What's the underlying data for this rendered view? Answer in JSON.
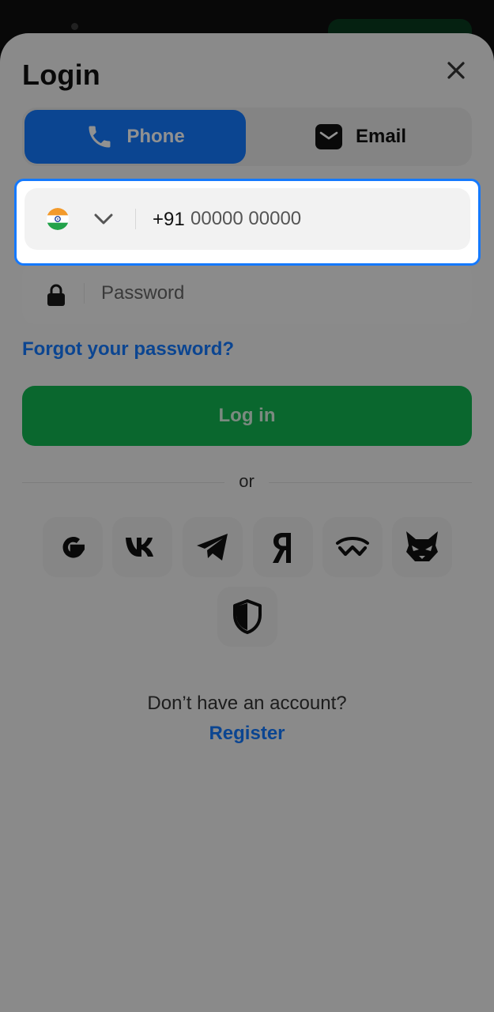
{
  "header": {
    "title": "Login"
  },
  "tabs": [
    {
      "label": "Phone",
      "icon": "phone-icon",
      "active": true
    },
    {
      "label": "Email",
      "icon": "email-icon",
      "active": false
    }
  ],
  "phone": {
    "country_icon": "india-flag-icon",
    "country_code": "+91",
    "placeholder": "00000 00000"
  },
  "password": {
    "placeholder": "Password"
  },
  "links": {
    "forgot": "Forgot your password?",
    "no_account": "Don’t have an account?",
    "register": "Register"
  },
  "login_button": {
    "label": "Log in"
  },
  "divider": {
    "label": "or"
  },
  "social": [
    {
      "name": "google-icon"
    },
    {
      "name": "vk-icon"
    },
    {
      "name": "telegram-icon"
    },
    {
      "name": "yandex-icon"
    },
    {
      "name": "walletconnect-icon"
    },
    {
      "name": "metamask-fox-icon"
    },
    {
      "name": "shield-icon"
    }
  ],
  "colors": {
    "accent_blue": "#1479ff",
    "login_green": "#13b551",
    "overlay": "rgba(0,0,0,0.43)"
  }
}
